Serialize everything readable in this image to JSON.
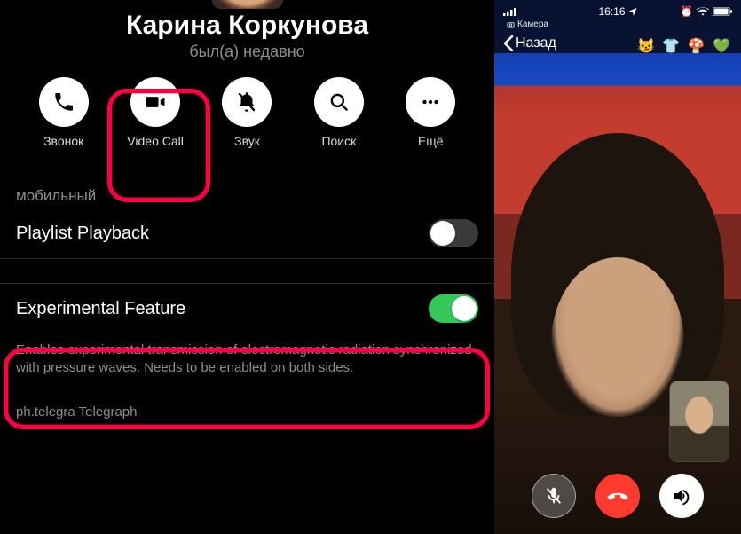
{
  "contact": {
    "name": "Карина Коркунова",
    "status": "был(а) недавно"
  },
  "actions": {
    "call": "Звонок",
    "video_call": "Video Call",
    "mute": "Звук",
    "search": "Поиск",
    "more": "Ещё"
  },
  "sections": {
    "mobile_label": "мобильный"
  },
  "toggles": {
    "playlist": {
      "label": "Playlist Playback",
      "on": false
    },
    "experimental": {
      "label": "Experimental Feature",
      "on": true,
      "hint": "Enables experimental transmission of electromagnetic radiation synchronized with pressure waves. Needs to be enabled on both sides."
    }
  },
  "footer": {
    "link": "ph.telegra Telegraph"
  },
  "call_screen": {
    "status_bar": {
      "camera_label": "Камера",
      "time": "16:16"
    },
    "back_label": "Назад",
    "emojis": "😼 👕 🍄 💚"
  }
}
